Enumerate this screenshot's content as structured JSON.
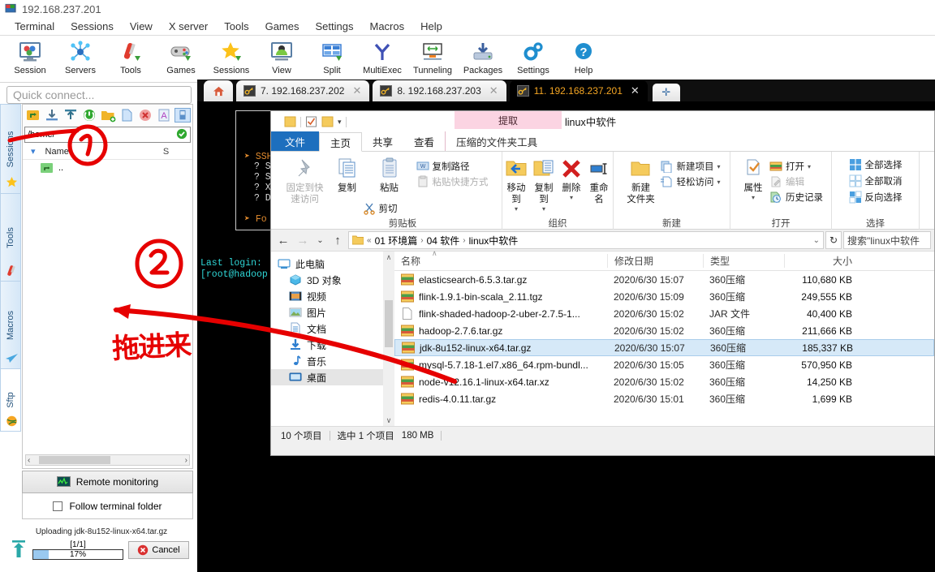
{
  "moba": {
    "title": "192.168.237.201",
    "menu": [
      "Terminal",
      "Sessions",
      "View",
      "X server",
      "Tools",
      "Games",
      "Settings",
      "Macros",
      "Help"
    ],
    "ribbon": [
      {
        "label": "Session",
        "icon": "session-icon"
      },
      {
        "label": "Servers",
        "icon": "servers-icon"
      },
      {
        "label": "Tools",
        "icon": "tools-icon"
      },
      {
        "label": "Games",
        "icon": "games-icon"
      },
      {
        "label": "Sessions",
        "icon": "sessions-star-icon"
      },
      {
        "label": "View",
        "icon": "view-icon"
      },
      {
        "label": "Split",
        "icon": "split-icon"
      },
      {
        "label": "MultiExec",
        "icon": "multiexec-icon"
      },
      {
        "label": "Tunneling",
        "icon": "tunneling-icon"
      },
      {
        "label": "Packages",
        "icon": "packages-icon"
      },
      {
        "label": "Settings",
        "icon": "settings-gear-icon"
      },
      {
        "label": "Help",
        "icon": "help-icon"
      }
    ],
    "quick_connect_placeholder": "Quick connect...",
    "tabs": [
      {
        "label": "7. 192.168.237.202",
        "active": false
      },
      {
        "label": "8. 192.168.237.203",
        "active": false
      },
      {
        "label": "11. 192.168.237.201",
        "active": true
      }
    ],
    "side_tabs": [
      "Sessions",
      "Tools",
      "Macros",
      "Sftp"
    ],
    "sftp": {
      "path": "/home/",
      "column_name": "Name",
      "column_size": "S",
      "entries": [
        ".."
      ],
      "toolbar_icons": [
        "upload-parent-icon",
        "download-icon",
        "upload-icon",
        "refresh-icon",
        "new-folder-icon",
        "new-file-icon",
        "delete-icon",
        "text-mode-icon",
        "usb-icon"
      ]
    },
    "remote_monitoring": "Remote monitoring",
    "follow_terminal_folder": "Follow terminal folder",
    "upload": {
      "label": "Uploading jdk-8u152-linux-x64.tar.gz",
      "count": "[1/1]",
      "percent": "17%",
      "cancel": "Cancel"
    },
    "terminal": {
      "box_lines": [
        "➤ SSH",
        "? S",
        "? S",
        "? X",
        "? D",
        "➤ Fo"
      ],
      "lines": [
        "Last login:",
        "[root@hadoop"
      ]
    }
  },
  "explorer": {
    "window_title": "linux中软件",
    "contextual_tab": "提取",
    "tabs": [
      "文件",
      "主页",
      "共享",
      "查看",
      "压缩的文件夹工具"
    ],
    "active_tab_index": 1,
    "ribbon_groups": [
      {
        "name": "剪贴板",
        "big": [
          {
            "label": "固定到快\n速访问",
            "icon": "pin-icon",
            "dim": true
          },
          {
            "label": "复制",
            "icon": "copy-icon"
          },
          {
            "label": "粘贴",
            "icon": "paste-icon"
          }
        ],
        "small": [
          {
            "label": "复制路径",
            "icon": "copy-path-icon"
          },
          {
            "label": "粘贴快捷方式",
            "icon": "paste-shortcut-icon",
            "dim": true
          }
        ],
        "small2": [
          {
            "label": "剪切",
            "icon": "cut-icon"
          }
        ]
      },
      {
        "name": "组织",
        "big": [
          {
            "label": "移动到",
            "icon": "move-to-icon",
            "caret": true
          },
          {
            "label": "复制到",
            "icon": "copy-to-icon",
            "caret": true
          },
          {
            "label": "删除",
            "icon": "delete-x-icon",
            "caret": true
          },
          {
            "label": "重命名",
            "icon": "rename-icon"
          }
        ]
      },
      {
        "name": "新建",
        "big": [
          {
            "label": "新建\n文件夹",
            "icon": "new-folder-icon"
          }
        ],
        "small": [
          {
            "label": "新建项目",
            "icon": "new-item-icon",
            "caret": true
          },
          {
            "label": "轻松访问",
            "icon": "easy-access-icon",
            "caret": true
          }
        ]
      },
      {
        "name": "打开",
        "big": [
          {
            "label": "属性",
            "icon": "properties-icon",
            "caret": true
          }
        ],
        "small": [
          {
            "label": "打开",
            "icon": "open-icon",
            "caret": true
          },
          {
            "label": "编辑",
            "icon": "edit-icon",
            "dim": true
          },
          {
            "label": "历史记录",
            "icon": "history-icon"
          }
        ]
      },
      {
        "name": "选择",
        "small": [
          {
            "label": "全部选择",
            "icon": "select-all-icon"
          },
          {
            "label": "全部取消",
            "icon": "select-none-icon"
          },
          {
            "label": "反向选择",
            "icon": "invert-selection-icon"
          }
        ]
      }
    ],
    "breadcrumb": [
      "01 环境篇",
      "04 软件",
      "linux中软件"
    ],
    "search_placeholder": "搜索\"linux中软件",
    "nav_tree": [
      {
        "label": "此电脑",
        "icon": "computer-icon",
        "level": 0
      },
      {
        "label": "3D 对象",
        "icon": "3d-objects-icon",
        "level": 1
      },
      {
        "label": "视频",
        "icon": "videos-icon",
        "level": 1
      },
      {
        "label": "图片",
        "icon": "pictures-icon",
        "level": 1
      },
      {
        "label": "文档",
        "icon": "documents-icon",
        "level": 1
      },
      {
        "label": "下载",
        "icon": "downloads-icon",
        "level": 1
      },
      {
        "label": "音乐",
        "icon": "music-icon",
        "level": 1
      },
      {
        "label": "桌面",
        "icon": "desktop-icon",
        "level": 1,
        "selected": true
      }
    ],
    "columns": [
      "名称",
      "修改日期",
      "类型",
      "大小"
    ],
    "files": [
      {
        "name": "elasticsearch-6.5.3.tar.gz",
        "date": "2020/6/30 15:07",
        "type": "360压缩",
        "size": "110,680 KB",
        "icon": "archive-icon",
        "selected": false
      },
      {
        "name": "flink-1.9.1-bin-scala_2.11.tgz",
        "date": "2020/6/30 15:09",
        "type": "360压缩",
        "size": "249,555 KB",
        "icon": "archive-icon",
        "selected": false
      },
      {
        "name": "flink-shaded-hadoop-2-uber-2.7.5-1...",
        "date": "2020/6/30 15:02",
        "type": "JAR 文件",
        "size": "40,400 KB",
        "icon": "file-icon",
        "selected": false
      },
      {
        "name": "hadoop-2.7.6.tar.gz",
        "date": "2020/6/30 15:02",
        "type": "360压缩",
        "size": "211,666 KB",
        "icon": "archive-icon",
        "selected": false
      },
      {
        "name": "jdk-8u152-linux-x64.tar.gz",
        "date": "2020/6/30 15:07",
        "type": "360压缩",
        "size": "185,337 KB",
        "icon": "archive-icon",
        "selected": true
      },
      {
        "name": "mysql-5.7.18-1.el7.x86_64.rpm-bundl...",
        "date": "2020/6/30 15:05",
        "type": "360压缩",
        "size": "570,950 KB",
        "icon": "archive-icon",
        "selected": false
      },
      {
        "name": "node-v12.16.1-linux-x64.tar.xz",
        "date": "2020/6/30 15:02",
        "type": "360压缩",
        "size": "14,250 KB",
        "icon": "archive-icon",
        "selected": false
      },
      {
        "name": "redis-4.0.11.tar.gz",
        "date": "2020/6/30 15:01",
        "type": "360压缩",
        "size": "1,699 KB",
        "icon": "archive-icon",
        "selected": false
      }
    ],
    "status": {
      "count": "10 个项目",
      "selected": "选中 1 个项目",
      "size": "180 MB"
    }
  },
  "annotations": {
    "drag_text": "拖进来",
    "marker_1": "1",
    "marker_2": "2",
    "color": "#e60000"
  }
}
